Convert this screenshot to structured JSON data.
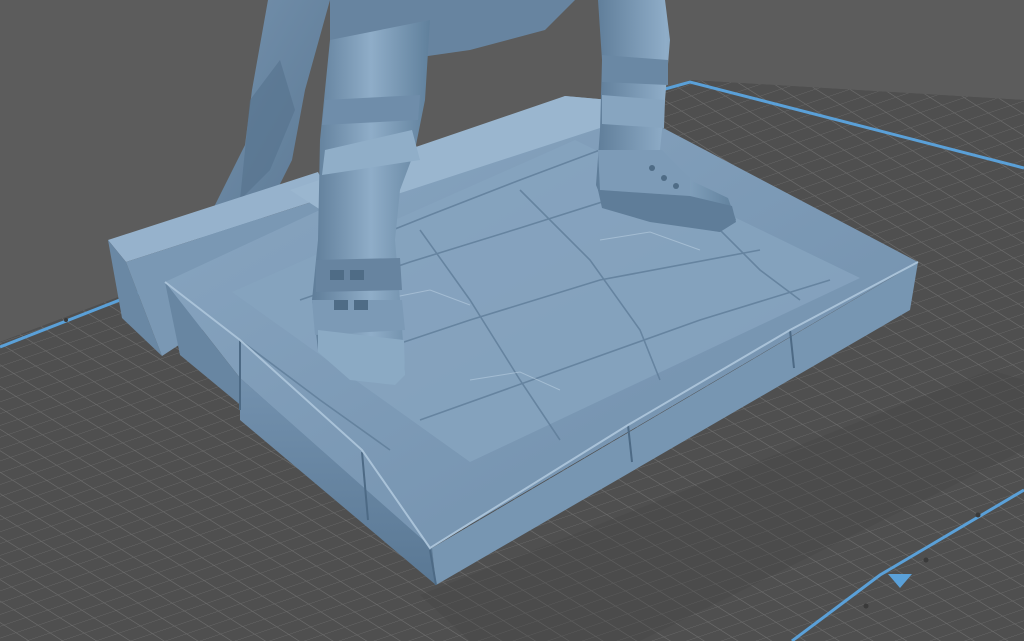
{
  "app": {
    "view": "3d-print-preview"
  },
  "scene": {
    "background_color": "#5c5c5c",
    "build_plate": {
      "surface_color": "#4f4f4f",
      "grid_line_color": "#6e6e6e",
      "edge_color": "#5aa0d8"
    },
    "model": {
      "base_color": "#7e9cb8",
      "shade_color": "#5e7c98",
      "highlight_color": "#a9c2d8"
    }
  }
}
